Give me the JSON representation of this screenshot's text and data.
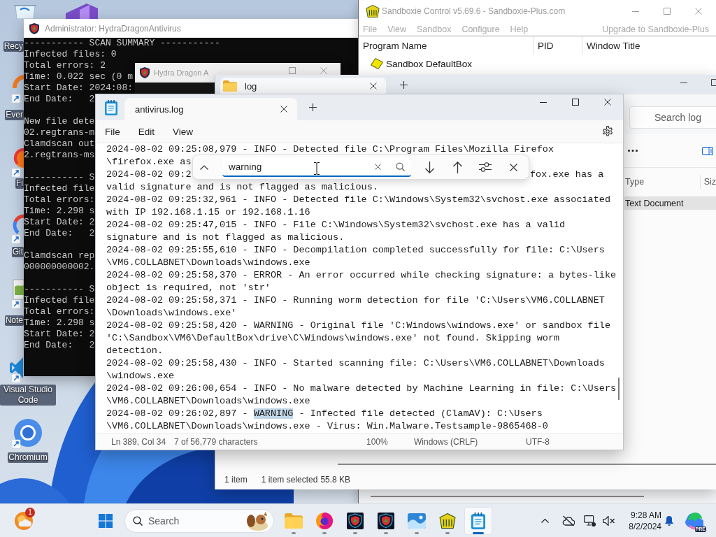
{
  "desktop": {
    "icons": [
      {
        "kind": "bin",
        "label": "Recy"
      },
      {
        "kind": "studio"
      },
      {
        "kind": "search-app",
        "label": "Ever"
      },
      {
        "kind": "fox",
        "label": "Fi"
      },
      {
        "kind": "git",
        "label": "Git"
      },
      {
        "kind": "notes",
        "label": "Note"
      },
      {
        "kind": "code",
        "label": "Visual Studio Code"
      },
      {
        "kind": "chromium",
        "label": "Chromium"
      }
    ]
  },
  "console_window": {
    "title": "Administrator: HydraDragonAntivirus",
    "blocks": [
      [
        "----------- SCAN SUMMARY -----------",
        "Infected files: 0",
        "Total errors: 2",
        "Time: 0.022 sec (0 m",
        "Start Date: 2024:08:",
        "End Date:   2"
      ],
      [
        "New file dete",
        "02.regtrans-m",
        "Clamdscan out",
        "2.regtrans-ms"
      ],
      [
        "----------- S",
        "Infected file",
        "Total errors:",
        "Time: 2.298 s",
        "Start Date: 2",
        "End Date:   2"
      ],
      [
        "Clamdscan rep",
        "000000000002."
      ],
      [
        "----------- S",
        "Infected file",
        "Total errors:",
        "Time: 2.298 s",
        "Start Date: 2",
        "End Date:   2"
      ]
    ]
  },
  "hydra_window": {
    "title": "Hydra Dragon A"
  },
  "sandboxie_window": {
    "title": "Sandboxie Control v5.69.6 - Sandboxie-Plus.com",
    "menu": [
      "File",
      "View",
      "Sandbox",
      "Configure",
      "Help"
    ],
    "upgrade_link": "Upgrade to Sandboxie-Plus",
    "columns": [
      "Program Name",
      "PID",
      "Window Title"
    ],
    "rows": [
      {
        "program_name": "Sandbox DefaultBox"
      }
    ]
  },
  "explorer_window": {
    "tabs": [
      {
        "label": "log",
        "selected": true
      }
    ],
    "search": {
      "placeholder": "Search log"
    },
    "columns": [
      "Type",
      "Siz"
    ],
    "rows": [
      {
        "type": "Text Document",
        "selected": true
      }
    ],
    "status_bar": {
      "items": "1 item",
      "selection": "1 item selected",
      "size": "55.8 KB"
    }
  },
  "notepad_window": {
    "tabs": [
      {
        "label": "antivirus.log",
        "selected": true
      }
    ],
    "menu": [
      "File",
      "Edit",
      "View"
    ],
    "find": {
      "value": "warning"
    },
    "lines": [
      {
        "text": "2024-08-02 09:25:08,979 - INFO - Detected file C:\\Program Files\\Mozilla Firefox"
      },
      {
        "text": "\\firefox.exe as"
      },
      {
        "pieces": [
          "2024-08-02 09:2",
          "fox.exe has a"
        ]
      },
      {
        "text": "valid signature and is not flagged as malicious."
      },
      {
        "text": "2024-08-02 09:25:32,961 - INFO - Detected file C:\\Windows\\System32\\svchost.exe associated"
      },
      {
        "text": "with IP 192.168.1.15 or 192.168.1.16"
      },
      {
        "text": "2024-08-02 09:25:47,015 - INFO - File C:\\Windows\\System32\\svchost.exe has a valid"
      },
      {
        "text": "signature and is not flagged as malicious."
      },
      {
        "text": "2024-08-02 09:25:55,610 - INFO - Decompilation completed successfully for file: C:\\Users"
      },
      {
        "text": "\\VM6.COLLABNET\\Downloads\\windows.exe"
      },
      {
        "text": "2024-08-02 09:25:58,370 - ERROR - An error occurred while checking signature: a bytes-like"
      },
      {
        "text": "object is required, not 'str'"
      },
      {
        "text": "2024-08-02 09:25:58,371 - INFO - Running worm detection for file 'C:\\Users\\VM6.COLLABNET"
      },
      {
        "text": "\\Downloads\\windows.exe'"
      },
      {
        "text": "2024-08-02 09:25:58,420 - WARNING - Original file 'C:Windows\\windows.exe' or sandbox file"
      },
      {
        "text": "'C:\\Sandbox\\VM6\\DefaultBox\\drive\\C\\Windows\\windows.exe' not found. Skipping worm"
      },
      {
        "text": "detection."
      },
      {
        "text": "2024-08-02 09:25:58,430 - INFO - Started scanning file: C:\\Users\\VM6.COLLABNET\\Downloads"
      },
      {
        "text": "\\windows.exe"
      },
      {
        "text": "2024-08-02 09:26:00,654 - INFO - No malware detected by Machine Learning in file: C:\\Users"
      },
      {
        "text": "\\VM6.COLLABNET\\Downloads\\windows.exe"
      },
      {
        "segments": [
          {
            "text": "2024-08-02 09:26:02,897 - ",
            "selected": false
          },
          {
            "text": "WARNING",
            "selected": true
          },
          {
            "text": " - Infected file detected (ClamAV): C:\\Users",
            "selected": false
          }
        ]
      },
      {
        "text": "\\VM6.COLLABNET\\Downloads\\windows.exe - Virus: Win.Malware.Testsample-9865468-0"
      }
    ],
    "status_bar": {
      "position": "Ln 389, Col 34",
      "count": "7 of 56,779 characters",
      "zoom": "100%",
      "line_ending": "Windows (CRLF)",
      "encoding": "UTF-8"
    }
  },
  "taskbar": {
    "notification_count": "1",
    "search": {
      "placeholder": "Search"
    },
    "apps": [
      {
        "kind": "folder",
        "selected": false
      },
      {
        "kind": "browser",
        "selected": false
      },
      {
        "kind": "shield",
        "selected": false
      },
      {
        "kind": "shield",
        "selected": false
      },
      {
        "kind": "picture",
        "selected": false
      },
      {
        "kind": "sandbox",
        "selected": false
      },
      {
        "kind": "notepad",
        "selected": true
      }
    ],
    "clock": {
      "time": "9:28 AM",
      "date": "8/2/2024"
    },
    "app_badge": "PRE"
  }
}
